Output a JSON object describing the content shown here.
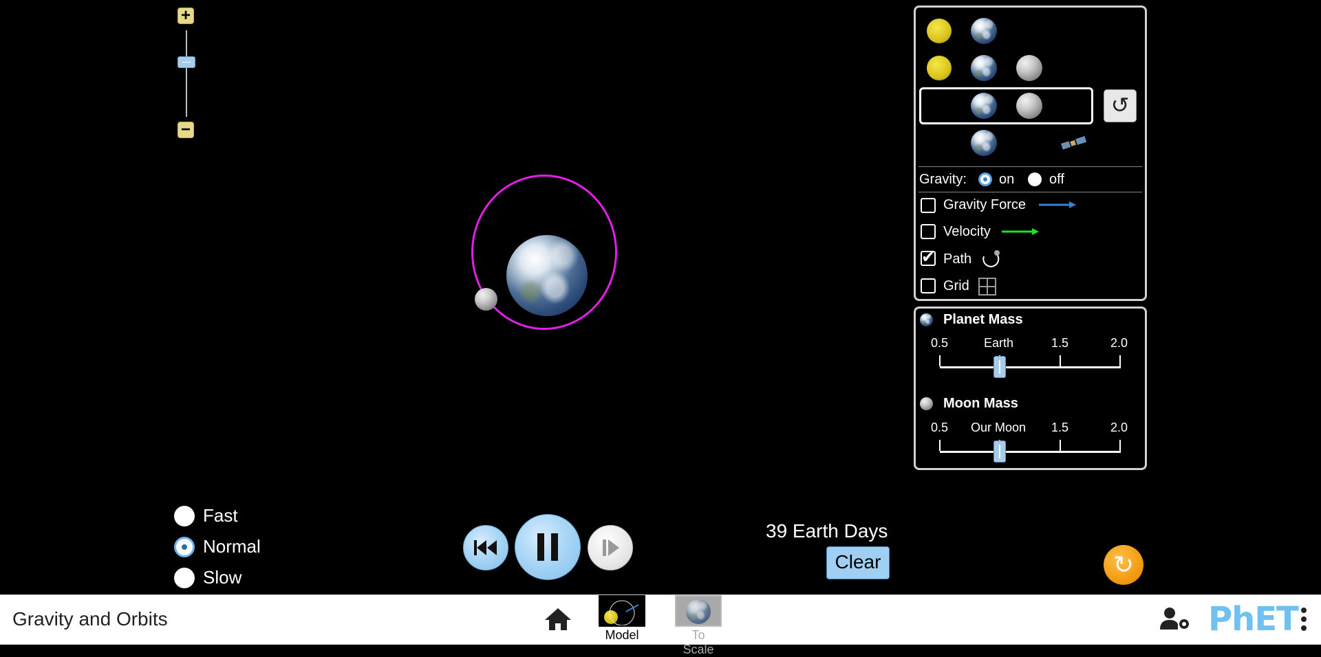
{
  "zoom": {
    "plus_icon": "+",
    "minus_icon": "−"
  },
  "scene": {
    "path_color": "#e31ee8"
  },
  "panel": {
    "gravity_label": "Gravity:",
    "gravity_on": "on",
    "gravity_off": "off",
    "gravity_force_label": "Gravity Force",
    "velocity_label": "Velocity",
    "path_label": "Path",
    "grid_label": "Grid",
    "path_checked": "✔"
  },
  "mass": {
    "planet_title": "Planet Mass",
    "planet_ticks": [
      "0.5",
      "Earth",
      "1.5",
      "2.0"
    ],
    "moon_title": "Moon Mass",
    "moon_ticks": [
      "0.5",
      "Our Moon",
      "1.5",
      "2.0"
    ]
  },
  "speed": {
    "fast": "Fast",
    "normal": "Normal",
    "slow": "Slow"
  },
  "time": {
    "elapsed": "39 Earth Days",
    "clear": "Clear"
  },
  "nav": {
    "title": "Gravity and Orbits",
    "screen_model": "Model",
    "screen_to_scale": "To Scale",
    "logo": "PhET"
  },
  "colors": {
    "gravity_arrow": "#3b7fd4",
    "velocity_arrow": "#22e02a",
    "accent": "#6fc1f0"
  }
}
